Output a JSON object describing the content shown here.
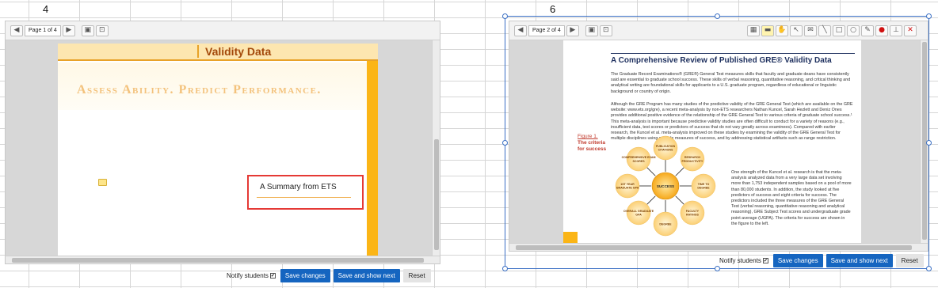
{
  "sheet": {
    "row_label_left": "4",
    "row_label_right": "6"
  },
  "left_viewer": {
    "page_indicator": "Page 1 of 4",
    "document": {
      "header_title": "Validity Data",
      "tagline": "Assess Ability. Predict Performance.",
      "summary_box_text": "A Summary from ETS"
    },
    "actions": {
      "notify_label": "Notify students",
      "notify_checked": "✔",
      "save_changes": "Save changes",
      "save_and_show_next": "Save and show next",
      "reset": "Reset"
    }
  },
  "right_viewer": {
    "page_indicator": "Page 2 of 4",
    "document": {
      "title": "A Comprehensive Review of Published GRE® Validity Data",
      "para1": "The Graduate Record Examinations® (GRE®) General Test measures skills that faculty and graduate deans have consistently said are essential to graduate school success. These skills of verbal reasoning, quantitative reasoning, and critical thinking and analytical writing are foundational skills for applicants to a U.S. graduate program, regardless of educational or linguistic background or country of origin.",
      "para2": "Although the GRE Program has many studies of the predictive validity of the GRE General Test (which are available on the GRE website: www.ets.org/gre), a recent meta-analysis by non-ETS researchers Nathan Kuncel, Sarah Hezlett and Deniz Ones provides additional positive evidence of the relationship of the GRE General Test to various criteria of graduate school success.¹ This meta-analysis is important because predictive validity studies are often difficult to conduct for a variety of reasons (e.g., insufficient data, test scores or predictors of success that do not vary greatly across examinees). Compared with earlier research, the Kuncel et al. meta-analysis improved on these studies by examining the validity of the GRE General Test for multiple disciplines using multiple measures of success, and by addressing statistical artifacts such as range restriction.",
      "para3": "One strength of the Kuncel et al. research is that the meta-analysis analyzed data from a very large data set involving more than 1,753 independent samples based on a pool of more than 80,000 students. In addition, the study looked at five predictors of success and eight criteria for success. The predictors included the three measures of the GRE General Test (verbal reasoning, quantitative reasoning and analytical reasoning), GRE Subject Test scores and undergraduate grade point average (UGPA). The criteria for success are shown in the figure to the left.",
      "figure_label": "Figure 1.",
      "figure_caption_1": "The criteria",
      "figure_caption_2": "for success",
      "diagram": {
        "center": "SUCCESS",
        "nodes": [
          "PUBLICATION CITATIONS",
          "RESEARCH PRODUCTIVITY",
          "TIME TO DEGREE",
          "FACULTY RATINGS",
          "DEGREE",
          "OVERALL GRADUATE GPA",
          "1ST YEAR GRADUATE GPA",
          "COMPREHENSIVE EXAM SCORES"
        ]
      }
    },
    "actions": {
      "notify_label": "Notify students",
      "notify_checked": "✔",
      "save_changes": "Save changes",
      "save_and_show_next": "Save and show next",
      "reset": "Reset"
    }
  },
  "toolbar_icons": [
    "prev-page-icon",
    "next-page-icon",
    "fit-page-icon",
    "fit-width-icon",
    "select-area-icon",
    "highlight-icon",
    "pan-icon",
    "pointer-icon",
    "comment-icon",
    "line-icon",
    "rectangle-icon",
    "ellipse-icon",
    "draw-icon",
    "color-icon",
    "stamp-icon",
    "delete-icon"
  ]
}
